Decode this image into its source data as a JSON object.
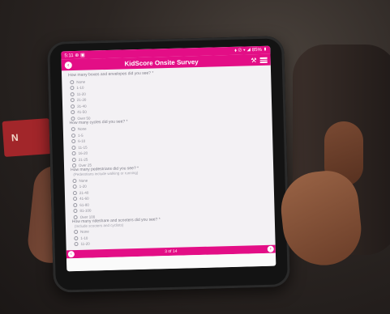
{
  "status_bar": {
    "time": "5:11",
    "indicators": "⊕ ▣",
    "right": "⬧ ⊘ ▾ ◢ 85% ▮"
  },
  "app_bar": {
    "title": "KidScore Onsite Survey",
    "back_icon": "back-arrow-icon",
    "tools_icon": "tools-icon",
    "menu_icon": "menu-icon"
  },
  "questions": [
    {
      "text": "How many boxes and envelopes did you see? *",
      "options": [
        "None",
        "1-10",
        "11-20",
        "21-30",
        "31-40",
        "41-50",
        "Over 50"
      ]
    },
    {
      "text": "How many cycles did you see? *",
      "options": [
        "None",
        "1-5",
        "6-10",
        "11-15",
        "16-20",
        "21-25",
        "Over 25"
      ]
    },
    {
      "text": "How many pedestrians did you see? *",
      "hint": "(Pedestrians include walking or running)",
      "options": [
        "None",
        "1-20",
        "21-40",
        "41-60",
        "61-80",
        "81-100",
        "Over 100"
      ]
    },
    {
      "text": "How many rideshare and scooters did you see? *",
      "hint": "(Include scooters and cyclists)",
      "options": [
        "None",
        "1-10",
        "11-20"
      ]
    }
  ],
  "pager": {
    "label": "3 of 14",
    "prev_icon": "chevron-left-icon",
    "next_icon": "chevron-right-icon"
  },
  "colors": {
    "accent": "#e30e86",
    "screen_background": "#f3f1f4"
  }
}
